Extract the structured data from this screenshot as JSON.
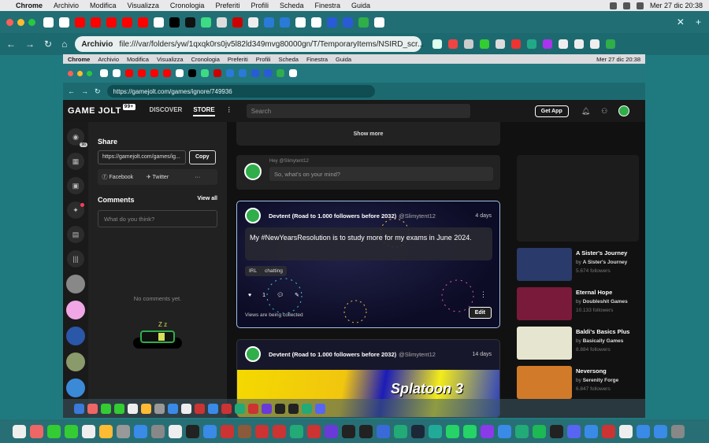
{
  "menubar": {
    "app": "Chrome",
    "items": [
      "Archivio",
      "Modifica",
      "Visualizza",
      "Cronologia",
      "Preferiti",
      "Profili",
      "Scheda",
      "Finestra",
      "Guida"
    ],
    "datetime": "Mer 27 dic  20:38"
  },
  "outer_toolbar": {
    "tag": "Archivio",
    "url": "file:///var/folders/yw/1qxqk0rs0jv5l82ld349mvg80000gn/T/TemporaryItems/NSIRD_scr..."
  },
  "inner_menubar": {
    "app": "Chrome",
    "items": [
      "Archivio",
      "Modifica",
      "Visualizza",
      "Cronologia",
      "Preferiti",
      "Profili",
      "Scheda",
      "Finestra",
      "Guida"
    ],
    "datetime": "Mer 27 dic  20:38"
  },
  "inner_toolbar": {
    "url": "https://gamejolt.com/games/ignore/749936"
  },
  "header": {
    "logo": "GAME JOLT",
    "badge": "99+",
    "nav": [
      "DISCOVER",
      "STORE"
    ],
    "search_placeholder": "Search",
    "get_app": "Get App"
  },
  "leftbar": {
    "count_badge": "96"
  },
  "share": {
    "heading": "Share",
    "url": "https://gamejolt.com/games/ig...",
    "copy": "Copy",
    "facebook": "Facebook",
    "twitter": "Twitter"
  },
  "comments": {
    "heading": "Comments",
    "view_all": "View all",
    "placeholder": "What do you think?",
    "empty": "No comments yet."
  },
  "feed": {
    "show_more": "Show more",
    "composer": {
      "greeting": "Hey @Slimytent12",
      "placeholder": "So, what's on your mind?"
    },
    "post1": {
      "author": "Devtent (Road to 1.000 followers before 2032)",
      "handle": "@Slimytent12",
      "time": "4 days",
      "text": "My #NewYearsResolution is to study more for my exams in June 2024.",
      "chips": [
        "IRL",
        "chatting"
      ],
      "likes": "1",
      "views": "Views are being collected",
      "edit": "Edit"
    },
    "post2": {
      "author": "Devtent (Road to 1.000 followers before 2032)",
      "handle": "@Slimytent12",
      "time": "14 days",
      "banner": "Splatoon 3"
    }
  },
  "recommended": [
    {
      "title": "A Sister's Journey",
      "by": "by",
      "dev": "A Sister's Journey",
      "followers": "5.674 followers",
      "color": "#2a3a6a"
    },
    {
      "title": "Eternal Hope",
      "by": "by",
      "dev": "Doubleshit Games",
      "followers": "10.133 followers",
      "color": "#7a1a3a"
    },
    {
      "title": "Baldi's Basics Plus",
      "by": "by",
      "dev": "Basically Games",
      "followers": "8.884 followers",
      "color": "#e6e6d0"
    },
    {
      "title": "Neversong",
      "by": "by",
      "dev": "Serenity Forge",
      "followers": "6.847 followers",
      "color": "#d07a2a"
    }
  ]
}
